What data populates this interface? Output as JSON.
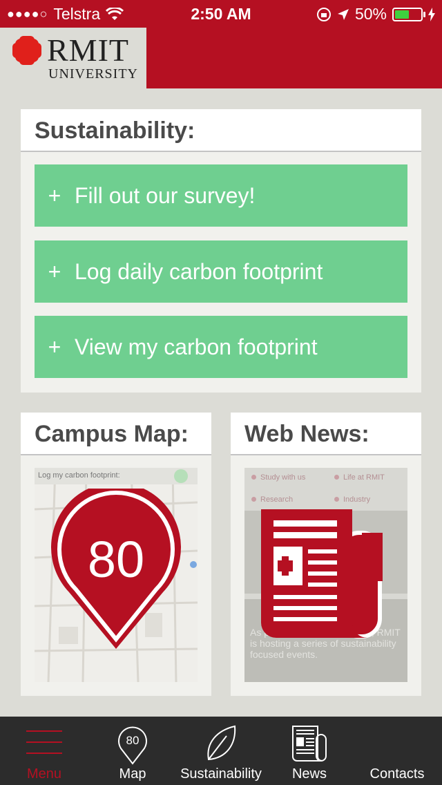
{
  "status_bar": {
    "signal": "●●●●○",
    "carrier": "Telstra",
    "time": "2:50 AM",
    "battery": "50%"
  },
  "logo": {
    "name": "RMIT",
    "sub": "UNIVERSITY"
  },
  "sustainability": {
    "title": "Sustainability:",
    "buttons": [
      {
        "plus": "+",
        "label": "Fill out our survey!"
      },
      {
        "plus": "+",
        "label": "Log daily carbon footprint"
      },
      {
        "plus": "+",
        "label": "View my carbon footprint"
      }
    ]
  },
  "campus_map": {
    "title": "Campus Map:",
    "preview_header": "Log my carbon footprint:",
    "pin_value": "80"
  },
  "web_news": {
    "title": "Web News:",
    "preview": {
      "tabs": [
        "Study with us",
        "Life at RMIT",
        "Research",
        "Industry"
      ],
      "body": "As part of the Living Festival, RMIT is hosting a series of sustainability focused events."
    }
  },
  "tab_bar": {
    "items": [
      {
        "label": "Menu"
      },
      {
        "label": "Map",
        "badge": "80"
      },
      {
        "label": "Sustainability"
      },
      {
        "label": "News"
      },
      {
        "label": "Contacts"
      }
    ]
  },
  "colors": {
    "brand_red": "#b51022",
    "green_button": "#6fcf90",
    "tab_bar": "#2c2c2c",
    "background": "#dcdcd6"
  }
}
